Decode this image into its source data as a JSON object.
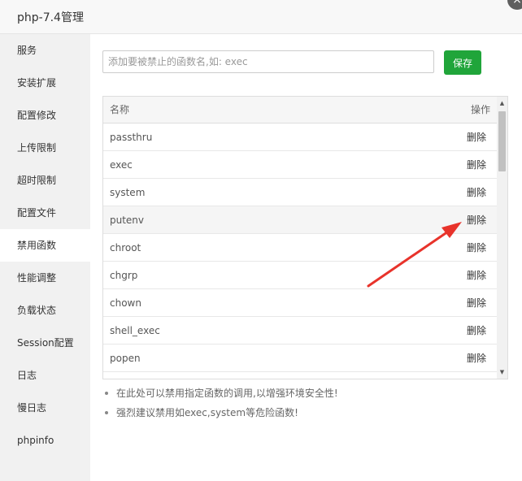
{
  "window": {
    "title": "php-7.4管理",
    "close_icon": "close-icon",
    "close_glyph": "×"
  },
  "sidebar": {
    "items": [
      {
        "label": "服务"
      },
      {
        "label": "安装扩展"
      },
      {
        "label": "配置修改"
      },
      {
        "label": "上传限制"
      },
      {
        "label": "超时限制"
      },
      {
        "label": "配置文件"
      },
      {
        "label": "禁用函数",
        "active": true
      },
      {
        "label": "性能调整"
      },
      {
        "label": "负载状态"
      },
      {
        "label": "Session配置"
      },
      {
        "label": "日志"
      },
      {
        "label": "慢日志"
      },
      {
        "label": "phpinfo"
      }
    ]
  },
  "form": {
    "placeholder": "添加要被禁止的函数名,如: exec",
    "value": "",
    "save_label": "保存"
  },
  "table": {
    "header_name": "名称",
    "header_action": "操作",
    "rows": [
      {
        "name": "passthru",
        "action": "删除"
      },
      {
        "name": "exec",
        "action": "删除"
      },
      {
        "name": "system",
        "action": "删除"
      },
      {
        "name": "putenv",
        "action": "删除"
      },
      {
        "name": "chroot",
        "action": "删除"
      },
      {
        "name": "chgrp",
        "action": "删除"
      },
      {
        "name": "chown",
        "action": "删除"
      },
      {
        "name": "shell_exec",
        "action": "删除"
      },
      {
        "name": "popen",
        "action": "删除"
      }
    ]
  },
  "notes": [
    "在此处可以禁用指定函数的调用,以增强环境安全性!",
    "强烈建议禁用如exec,system等危险函数!"
  ],
  "colors": {
    "accent_green": "#20a53a",
    "annotation_red": "#e8332b"
  }
}
